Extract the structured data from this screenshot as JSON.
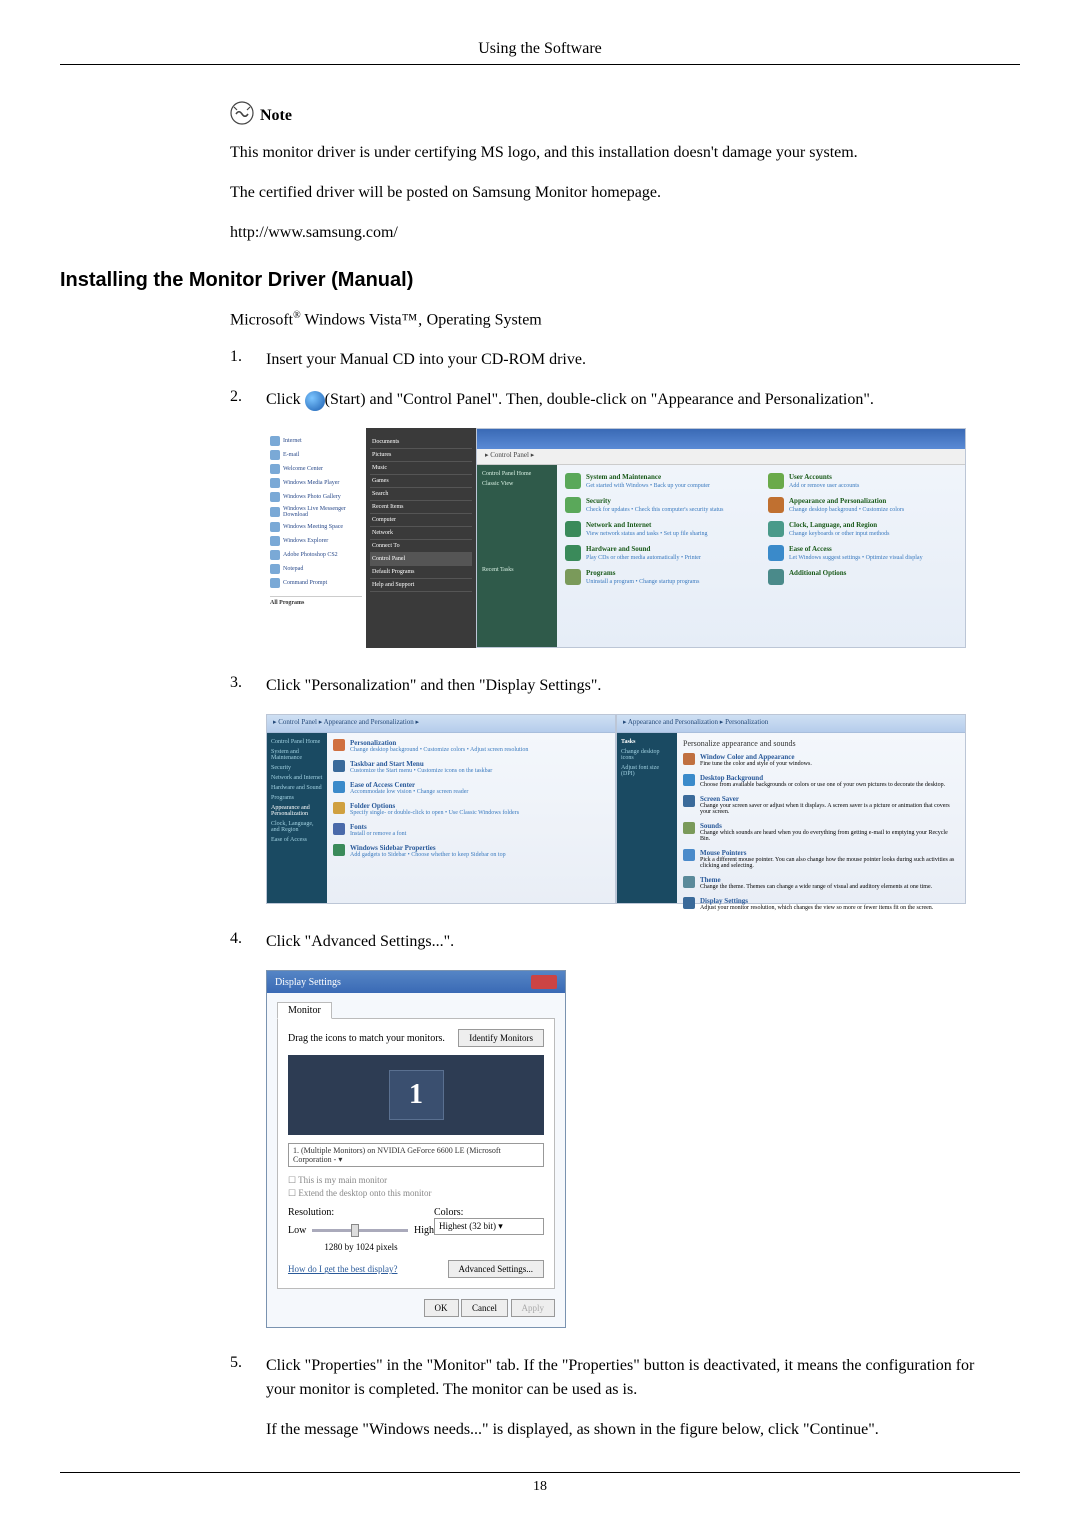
{
  "header": {
    "title": "Using the Software"
  },
  "note": {
    "label": "Note",
    "lines": [
      "This monitor driver is under certifying MS logo, and this installation doesn't damage your system.",
      "The certified driver will be posted on Samsung Monitor homepage.",
      "http://www.samsung.com/"
    ]
  },
  "section": {
    "heading": "Installing the Monitor Driver (Manual)",
    "os": {
      "prefix": "Microsoft",
      "reg": "®",
      "rest": " Windows Vista™‚ Operating System"
    }
  },
  "steps": {
    "s1": {
      "num": "1.",
      "text": "Insert your Manual CD into your CD-ROM drive."
    },
    "s2": {
      "num": "2.",
      "pre": "Click ",
      "post": "(Start) and \"Control Panel\". Then, double-click on \"Appearance and Personalization\"."
    },
    "s3": {
      "num": "3.",
      "text": "Click \"Personalization\" and then \"Display Settings\"."
    },
    "s4": {
      "num": "4.",
      "text": "Click \"Advanced Settings...\"."
    },
    "s5": {
      "num": "5.",
      "p1": "Click \"Properties\" in the \"Monitor\" tab. If the \"Properties\" button is deactivated, it means the configuration for your monitor is completed. The monitor can be used as is.",
      "p2": "If the message \"Windows needs...\" is displayed, as shown in the figure below, click \"Continue\"."
    }
  },
  "fig1": {
    "startmenu_items": [
      "Internet",
      "E-mail",
      "Welcome Center",
      "Windows Media Player",
      "Windows Photo Gallery",
      "Windows Live Messenger Download",
      "Windows Meeting Space",
      "Windows Explorer",
      "Adobe Photoshop CS2",
      "Notepad",
      "Command Prompt"
    ],
    "startmenu_bottom": "All Programs",
    "rightmenu": [
      "Documents",
      "Pictures",
      "Music",
      "Games",
      "Search",
      "Recent Items",
      "Computer",
      "Network",
      "Connect To",
      "Control Panel",
      "Default Programs",
      "Help and Support"
    ],
    "cp_addr": "▸ Control Panel ▸",
    "cp_side": [
      "Control Panel Home",
      "Classic View"
    ],
    "cp_side_tasks": "Recent Tasks",
    "cp_items": [
      {
        "title": "System and Maintenance",
        "sub": "Get started with Windows • Back up your computer",
        "color": "#5aa85a"
      },
      {
        "title": "User Accounts",
        "sub": "Add or remove user accounts",
        "color": "#6aaa4a"
      },
      {
        "title": "Security",
        "sub": "Check for updates • Check this computer's security status",
        "color": "#5aa85a"
      },
      {
        "title": "Appearance and Personalization",
        "sub": "Change desktop background • Customize colors",
        "color": "#c07030"
      },
      {
        "title": "Network and Internet",
        "sub": "View network status and tasks • Set up file sharing",
        "color": "#3a8a5a"
      },
      {
        "title": "Clock, Language, and Region",
        "sub": "Change keyboards or other input methods",
        "color": "#4a9a8a"
      },
      {
        "title": "Hardware and Sound",
        "sub": "Play CDs or other media automatically • Printer",
        "color": "#3a8a5a"
      },
      {
        "title": "Ease of Access",
        "sub": "Let Windows suggest settings • Optimize visual display",
        "color": "#3a8aca"
      },
      {
        "title": "Programs",
        "sub": "Uninstall a program • Change startup programs",
        "color": "#7a9a5a"
      },
      {
        "title": "Additional Options",
        "sub": "",
        "color": "#4a8a8a"
      }
    ]
  },
  "fig2": {
    "left_addr": "▸ Control Panel ▸ Appearance and Personalization ▸",
    "left_side": [
      "Control Panel Home",
      "System and Maintenance",
      "Security",
      "Network and Internet",
      "Hardware and Sound",
      "Programs",
      "Appearance and Personalization",
      "Clock, Language, and Region",
      "Ease of Access"
    ],
    "left_items": [
      {
        "title": "Personalization",
        "sub": "Change desktop background • Customize colors • Adjust screen resolution",
        "color": "#d07040"
      },
      {
        "title": "Taskbar and Start Menu",
        "sub": "Customize the Start menu • Customize icons on the taskbar",
        "color": "#3a6a9a"
      },
      {
        "title": "Ease of Access Center",
        "sub": "Accommodate low vision • Change screen reader",
        "color": "#3a8aca"
      },
      {
        "title": "Folder Options",
        "sub": "Specify single- or double-click to open • Use Classic Windows folders",
        "color": "#d0a040"
      },
      {
        "title": "Fonts",
        "sub": "Install or remove a font",
        "color": "#4a6aaa"
      },
      {
        "title": "Windows Sidebar Properties",
        "sub": "Add gadgets to Sidebar • Choose whether to keep Sidebar on top",
        "color": "#3a8a5a"
      }
    ],
    "right_addr": "▸ Appearance and Personalization ▸ Personalization",
    "right_title": "Personalize appearance and sounds",
    "right_side": [
      "Tasks",
      "Change desktop icons",
      "Adjust font size (DPI)"
    ],
    "right_items": [
      {
        "title": "Window Color and Appearance",
        "sub": "Fine tune the color and style of your windows."
      },
      {
        "title": "Desktop Background",
        "sub": "Choose from available backgrounds or colors or use one of your own pictures to decorate the desktop."
      },
      {
        "title": "Screen Saver",
        "sub": "Change your screen saver or adjust when it displays. A screen saver is a picture or animation that covers your screen."
      },
      {
        "title": "Sounds",
        "sub": "Change which sounds are heard when you do everything from getting e-mail to emptying your Recycle Bin."
      },
      {
        "title": "Mouse Pointers",
        "sub": "Pick a different mouse pointer. You can also change how the mouse pointer looks during such activities as clicking and selecting."
      },
      {
        "title": "Theme",
        "sub": "Change the theme. Themes can change a wide range of visual and auditory elements at one time."
      },
      {
        "title": "Display Settings",
        "sub": "Adjust your monitor resolution, which changes the view so more or fewer items fit on the screen."
      }
    ]
  },
  "fig3": {
    "title": "Display Settings",
    "tab": "Monitor",
    "drag": "Drag the icons to match your monitors.",
    "identify": "Identify Monitors",
    "monitor_num": "1",
    "select": "1. (Multiple Monitors) on NVIDIA GeForce 6600 LE (Microsoft Corporation - ▾",
    "check1": "☐ This is my main monitor",
    "check2": "☐ Extend the desktop onto this monitor",
    "res_label": "Resolution:",
    "res_low": "Low",
    "res_high": "High",
    "res_val": "1280 by 1024 pixels",
    "colors_label": "Colors:",
    "colors_val": "Highest (32 bit)    ▾",
    "link": "How do I get the best display?",
    "adv": "Advanced Settings...",
    "ok": "OK",
    "cancel": "Cancel",
    "apply": "Apply"
  },
  "page": {
    "num": "18"
  }
}
